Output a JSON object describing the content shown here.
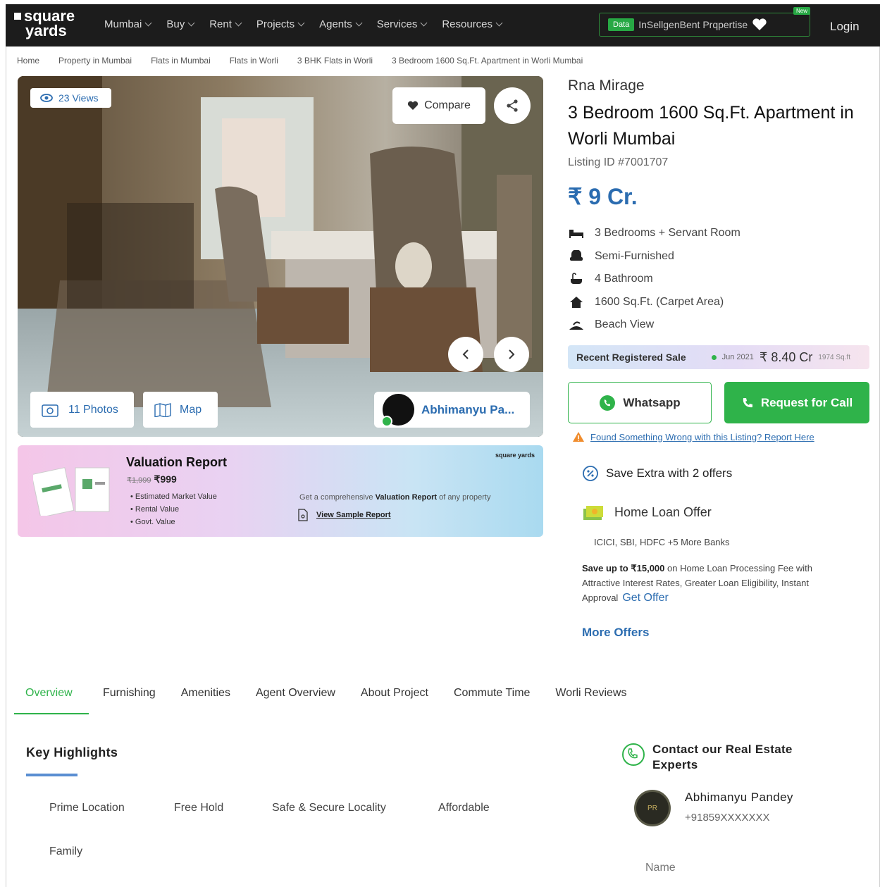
{
  "header": {
    "logo_line1": "square",
    "logo_line2": "yards",
    "nav": [
      "Mumbai",
      "Buy",
      "Rent",
      "Projects",
      "Agents",
      "Services",
      "Resources"
    ],
    "data_badge": "Data",
    "data_text": "InSellgenBent Prqpertise",
    "new_badge": "New",
    "login": "Login"
  },
  "breadcrumb": [
    "Home",
    "Property in Mumbai",
    "Flats in Mumbai",
    "Flats in Worli",
    "3 BHK Flats in Worli",
    "3 Bedroom 1600 Sq.Ft. Apartment in Worli Mumbai"
  ],
  "gallery": {
    "views": "23 Views",
    "compare": "Compare",
    "photos": "11 Photos",
    "map": "Map",
    "agent_short": "Abhimanyu Pa..."
  },
  "valuation": {
    "title": "Valuation Report",
    "old_price": "₹1,999",
    "price": "₹999",
    "items": [
      "Estimated Market Value",
      "Rental Value",
      "Govt. Value"
    ],
    "logo": "square yards",
    "desc_pre": "Get a comprehensive ",
    "desc_bold": "Valuation Report",
    "desc_post": " of any property",
    "sample": "View Sample Report"
  },
  "listing": {
    "project": "Rna Mirage",
    "title": "3 Bedroom 1600 Sq.Ft. Apartment in Worli Mumbai",
    "listing_id": "Listing ID #7001707",
    "price": "₹ 9 Cr.",
    "features": [
      {
        "icon": "bed-icon",
        "text": "3 Bedrooms + Servant Room"
      },
      {
        "icon": "sofa-icon",
        "text": "Semi-Furnished"
      },
      {
        "icon": "bathtub-icon",
        "text": "4 Bathroom"
      },
      {
        "icon": "home-icon",
        "text": "1600 Sq.Ft. (Carpet Area)"
      },
      {
        "icon": "beach-icon",
        "text": "Beach View"
      }
    ]
  },
  "recent_sale": {
    "label": "Recent Registered Sale",
    "date": "Jun 2021",
    "amount": "₹ 8.40 Cr",
    "area": "1974 Sq.ft"
  },
  "actions": {
    "whatsapp": "Whatsapp",
    "call": "Request for Call",
    "report": "Found Something Wrong with this Listing? Report Here"
  },
  "offers": {
    "heading": "Save Extra with 2 offers",
    "home_loan": "Home Loan Offer",
    "banks": "ICICI, SBI, HDFC +5 More Banks",
    "save_bold": "Save up to ₹15,000",
    "save_rest": " on Home Loan Processing Fee with Attractive Interest Rates, Greater Loan Eligibility, Instant Approval",
    "get_offer": "Get Offer",
    "more": "More Offers"
  },
  "tabs": [
    "Overview",
    "Furnishing",
    "Amenities",
    "Agent Overview",
    "About Project",
    "Commute Time",
    "Worli Reviews"
  ],
  "highlights": {
    "title": "Key Highlights",
    "items": [
      "Prime Location",
      "Free Hold",
      "Safe & Secure Locality",
      "Affordable",
      "Family"
    ]
  },
  "contact": {
    "title_line1": "Contact our Real Estate",
    "title_line2": "Experts",
    "agent_name": "Abhimanyu Pandey",
    "phone": "+91859XXXXXXX",
    "avatar_text": "PR",
    "name_label": "Name"
  },
  "colors": {
    "accent_blue": "#2b6cb0",
    "green": "#2fb34a",
    "header_bg": "#1c1c1c"
  }
}
